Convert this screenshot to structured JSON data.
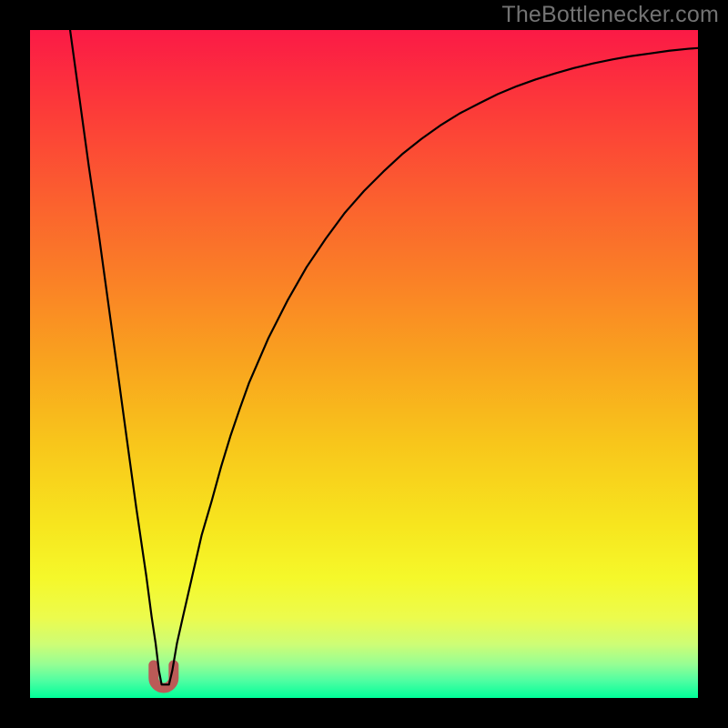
{
  "watermark": "TheBottlenecker.com",
  "chart_data": {
    "type": "line",
    "title": "",
    "xlabel": "",
    "ylabel": "",
    "xlim": [
      0,
      100
    ],
    "ylim": [
      0,
      100
    ],
    "series": [
      {
        "name": "bottleneck-curve",
        "color": "#000000",
        "x": [
          6.0,
          7.4,
          8.8,
          10.3,
          11.7,
          13.1,
          14.5,
          15.9,
          17.4,
          18.2,
          18.8,
          19.3,
          19.7,
          20.0,
          20.4,
          20.8,
          21.3,
          22.0,
          22.9,
          24.3,
          25.7,
          27.2,
          28.6,
          30.0,
          31.4,
          32.8,
          35.7,
          38.6,
          41.4,
          44.3,
          47.1,
          50.0,
          52.9,
          55.7,
          58.6,
          61.4,
          64.3,
          67.2,
          70.0,
          72.9,
          75.7,
          78.6,
          81.4,
          84.3,
          87.2,
          90.0,
          92.9,
          95.7,
          98.6,
          100.0
        ],
        "y": [
          100.0,
          89.8,
          79.6,
          69.4,
          59.2,
          49.0,
          38.7,
          28.5,
          18.3,
          12.2,
          8.2,
          4.1,
          2.0,
          2.0,
          2.0,
          2.0,
          4.1,
          8.2,
          12.2,
          18.3,
          24.4,
          29.5,
          34.6,
          39.2,
          43.3,
          47.2,
          53.9,
          59.6,
          64.5,
          68.8,
          72.6,
          75.9,
          78.8,
          81.4,
          83.7,
          85.7,
          87.5,
          89.0,
          90.4,
          91.6,
          92.6,
          93.5,
          94.3,
          95.0,
          95.6,
          96.1,
          96.5,
          96.9,
          97.2,
          97.3
        ]
      }
    ],
    "plateau_marker": {
      "color": "#bb5a57",
      "x_center": 20.0,
      "width": 3.0,
      "y": 2.7
    },
    "background_gradient": {
      "stops": [
        {
          "offset": 0.0,
          "color": "#fb1a46"
        },
        {
          "offset": 0.12,
          "color": "#fc3b39"
        },
        {
          "offset": 0.25,
          "color": "#fb5f2f"
        },
        {
          "offset": 0.38,
          "color": "#fa8226"
        },
        {
          "offset": 0.5,
          "color": "#f9a41e"
        },
        {
          "offset": 0.62,
          "color": "#f8c61b"
        },
        {
          "offset": 0.74,
          "color": "#f7e51e"
        },
        {
          "offset": 0.82,
          "color": "#f5f82a"
        },
        {
          "offset": 0.88,
          "color": "#ecfb4d"
        },
        {
          "offset": 0.92,
          "color": "#cdfd76"
        },
        {
          "offset": 0.95,
          "color": "#95fe94"
        },
        {
          "offset": 0.975,
          "color": "#4dfea2"
        },
        {
          "offset": 1.0,
          "color": "#00ff99"
        }
      ]
    }
  }
}
